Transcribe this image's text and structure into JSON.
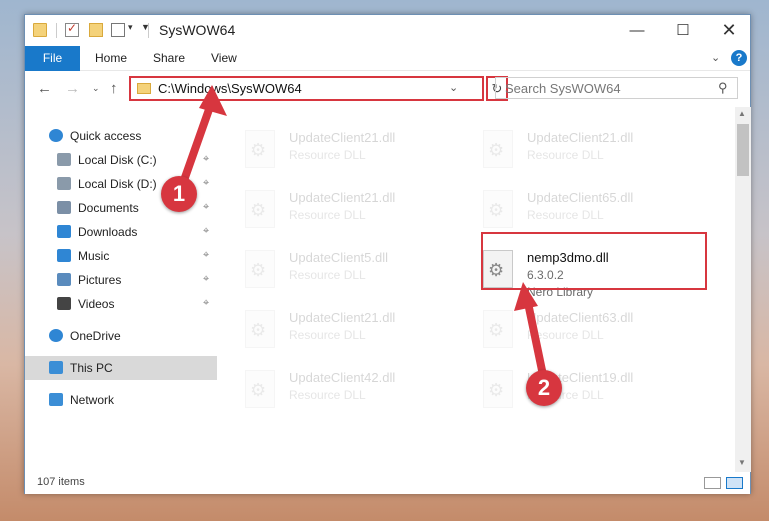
{
  "window": {
    "title": "SysWOW64",
    "minimize_glyph": "—",
    "maximize_glyph": "☐",
    "close_glyph": "✕"
  },
  "ribbon": {
    "tabs": [
      "File",
      "Home",
      "Share",
      "View"
    ],
    "help_glyph": "?"
  },
  "nav": {
    "address": "C:\\Windows\\SysWOW64",
    "search_placeholder": "Search SysWOW64"
  },
  "sidebar": {
    "items": [
      {
        "label": "Quick access",
        "icon": "star-icon",
        "pinned": false
      },
      {
        "label": "Local Disk (C:)",
        "icon": "drive-icon",
        "pinned": true
      },
      {
        "label": "Local Disk (D:)",
        "icon": "drive-icon",
        "pinned": true
      },
      {
        "label": "Documents",
        "icon": "documents-icon",
        "pinned": true
      },
      {
        "label": "Downloads",
        "icon": "download-icon",
        "pinned": true
      },
      {
        "label": "Music",
        "icon": "music-icon",
        "pinned": true
      },
      {
        "label": "Pictures",
        "icon": "pictures-icon",
        "pinned": true
      },
      {
        "label": "Videos",
        "icon": "videos-icon",
        "pinned": true
      },
      {
        "label": "OneDrive",
        "icon": "cloud-icon",
        "pinned": false
      },
      {
        "label": "This PC",
        "icon": "computer-icon",
        "pinned": false,
        "selected": true
      },
      {
        "label": "Network",
        "icon": "network-icon",
        "pinned": false
      }
    ]
  },
  "files": {
    "items": [
      {
        "name": "UpdateClient21.dll",
        "desc": "Resource DLL",
        "faded": true
      },
      {
        "name": "UpdateClient21.dll",
        "desc": "Resource DLL",
        "faded": true
      },
      {
        "name": "UpdateClient21.dll",
        "desc": "Resource DLL",
        "faded": true
      },
      {
        "name": "UpdateClient65.dll",
        "desc": "Resource DLL",
        "faded": true
      },
      {
        "name": "UpdateClient5.dll",
        "desc": "Resource DLL",
        "faded": true
      },
      {
        "name": "nemp3dmo.dll",
        "version": "6.3.0.2",
        "desc": "Nero Library",
        "faded": false
      },
      {
        "name": "UpdateClient21.dll",
        "desc": "Resource DLL",
        "faded": true
      },
      {
        "name": "UpdateClient63.dll",
        "desc": "Resource DLL",
        "faded": true
      },
      {
        "name": "UpdateClient42.dll",
        "desc": "Resource DLL",
        "faded": true
      },
      {
        "name": "UpdateClient19.dll",
        "desc": "Resource DLL",
        "faded": true
      }
    ]
  },
  "status": {
    "item_count": "107 items"
  },
  "annotations": {
    "badge1": "1",
    "badge2": "2",
    "accent": "#d7363f"
  }
}
